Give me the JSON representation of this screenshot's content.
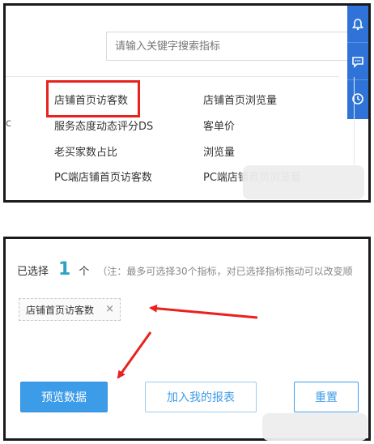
{
  "search": {
    "placeholder": "请输入关键字搜索指标"
  },
  "metrics": {
    "left_cut": "c",
    "col1": [
      "店铺首页访客数",
      "服务态度动态评分DS",
      "老买家数占比",
      "PC端店铺首页访客数"
    ],
    "col2": [
      "店铺首页浏览量",
      "客单价",
      "浏览量",
      "PC端店铺首页浏览量"
    ]
  },
  "side_icons": [
    "bell-icon",
    "chat-icon",
    "clock-icon"
  ],
  "selection": {
    "prefix": "已选择",
    "count": "1",
    "unit": "个",
    "note": "（注：最多可选择30个指标，对已选择指标拖动可以改变顺",
    "tag_label": "店铺首页访客数",
    "tag_remove": "×"
  },
  "buttons": {
    "preview": "预览数据",
    "add_report": "加入我的报表",
    "reset": "重置"
  },
  "annotation_color": "#e8231f",
  "accent_color": "#3d9ce8"
}
